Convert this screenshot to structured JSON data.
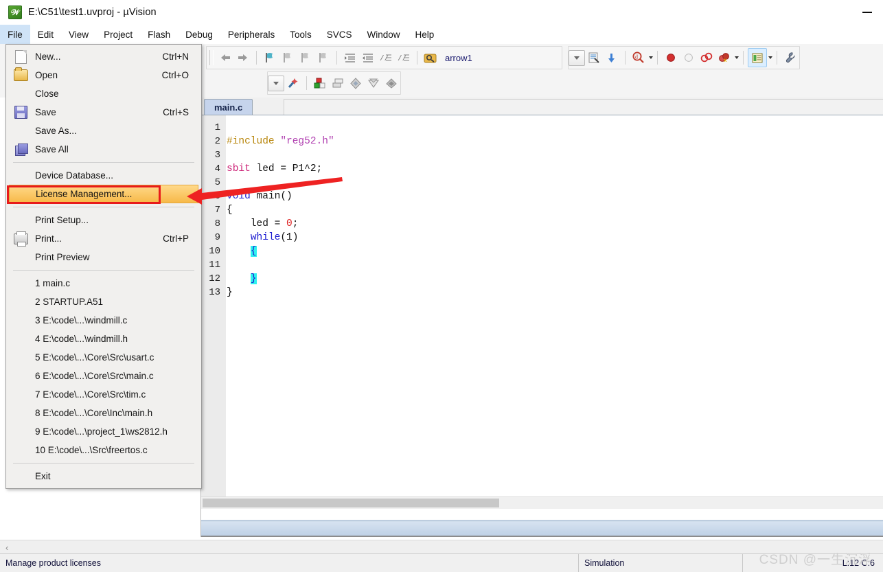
{
  "window": {
    "title": "E:\\C51\\test1.uvproj - µVision",
    "app_icon": "keil-uvision-icon",
    "minimize_label": "—"
  },
  "menubar": {
    "items": [
      {
        "label": "File",
        "open": true
      },
      {
        "label": "Edit",
        "open": false
      },
      {
        "label": "View",
        "open": false
      },
      {
        "label": "Project",
        "open": false
      },
      {
        "label": "Flash",
        "open": false
      },
      {
        "label": "Debug",
        "open": false
      },
      {
        "label": "Peripherals",
        "open": false
      },
      {
        "label": "Tools",
        "open": false
      },
      {
        "label": "SVCS",
        "open": false
      },
      {
        "label": "Window",
        "open": false
      },
      {
        "label": "Help",
        "open": false
      }
    ]
  },
  "file_menu": {
    "groups": [
      {
        "items": [
          {
            "label": "New...",
            "shortcut": "Ctrl+N",
            "icon": "new-file-icon",
            "highlighted": false
          },
          {
            "label": "Open",
            "shortcut": "Ctrl+O",
            "icon": "open-folder-icon",
            "highlighted": false
          },
          {
            "label": "Close",
            "shortcut": "",
            "icon": "",
            "highlighted": false
          },
          {
            "label": "Save",
            "shortcut": "Ctrl+S",
            "icon": "save-disk-icon",
            "highlighted": false
          },
          {
            "label": "Save As...",
            "shortcut": "",
            "icon": "",
            "highlighted": false
          },
          {
            "label": "Save All",
            "shortcut": "",
            "icon": "save-all-icon",
            "highlighted": false
          }
        ]
      },
      {
        "items": [
          {
            "label": "Device Database...",
            "shortcut": "",
            "icon": "",
            "highlighted": false
          },
          {
            "label": "License Management...",
            "shortcut": "",
            "icon": "",
            "highlighted": true
          }
        ]
      },
      {
        "items": [
          {
            "label": "Print Setup...",
            "shortcut": "",
            "icon": "",
            "highlighted": false
          },
          {
            "label": "Print...",
            "shortcut": "Ctrl+P",
            "icon": "printer-icon",
            "highlighted": false
          },
          {
            "label": "Print Preview",
            "shortcut": "",
            "icon": "",
            "highlighted": false
          }
        ]
      },
      {
        "items": [
          {
            "label": "1 main.c",
            "shortcut": "",
            "icon": "",
            "highlighted": false
          },
          {
            "label": "2 STARTUP.A51",
            "shortcut": "",
            "icon": "",
            "highlighted": false
          },
          {
            "label": "3 E:\\code\\...\\windmill.c",
            "shortcut": "",
            "icon": "",
            "highlighted": false
          },
          {
            "label": "4 E:\\code\\...\\windmill.h",
            "shortcut": "",
            "icon": "",
            "highlighted": false
          },
          {
            "label": "5 E:\\code\\...\\Core\\Src\\usart.c",
            "shortcut": "",
            "icon": "",
            "highlighted": false
          },
          {
            "label": "6 E:\\code\\...\\Core\\Src\\main.c",
            "shortcut": "",
            "icon": "",
            "highlighted": false
          },
          {
            "label": "7 E:\\code\\...\\Core\\Src\\tim.c",
            "shortcut": "",
            "icon": "",
            "highlighted": false
          },
          {
            "label": "8 E:\\code\\...\\Core\\Inc\\main.h",
            "shortcut": "",
            "icon": "",
            "highlighted": false
          },
          {
            "label": "9 E:\\code\\...\\project_1\\ws2812.h",
            "shortcut": "",
            "icon": "",
            "highlighted": false
          },
          {
            "label": "10 E:\\code\\...\\Src\\freertos.c",
            "shortcut": "",
            "icon": "",
            "highlighted": false
          }
        ]
      },
      {
        "items": [
          {
            "label": "Exit",
            "shortcut": "",
            "icon": "",
            "highlighted": false
          }
        ]
      }
    ]
  },
  "toolbar": {
    "target_label": "arrow1",
    "row1_icons": [
      "back-arrow-icon",
      "forward-arrow-icon",
      "bookmark-toggle-icon",
      "bookmark-prev-icon",
      "bookmark-next-icon",
      "bookmark-clear-icon",
      "indent-right-icon",
      "indent-left-icon",
      "comment-icon",
      "uncomment-icon",
      "target-options-icon"
    ],
    "row1_right_icons": [
      "target-dropdown-icon",
      "manage-project-items-icon",
      "configure-icon",
      "find-in-files-icon",
      "insert-breakpoint-icon",
      "disable-breakpoint-icon",
      "kill-all-breakpoints-icon",
      "disable-all-breakpoints-icon",
      "window-layout-icon",
      "utilities-icon"
    ],
    "row2_icons": [
      "dropdown-icon",
      "build-wizard-icon",
      "target-build-icon",
      "batch-build-icon",
      "translate-icon",
      "download-icon",
      "manage-components-icon"
    ]
  },
  "editor": {
    "tab_label": "main.c",
    "lines": [
      {
        "num": "1",
        "tokens": []
      },
      {
        "num": "2",
        "tokens": [
          {
            "t": "#include ",
            "c": "k-pre"
          },
          {
            "t": "\"reg52.h\"",
            "c": "k-str"
          }
        ]
      },
      {
        "num": "3",
        "tokens": []
      },
      {
        "num": "4",
        "tokens": [
          {
            "t": "sbit",
            "c": "k-type"
          },
          {
            "t": " led = P1^2;",
            "c": "k-plain"
          }
        ]
      },
      {
        "num": "5",
        "tokens": []
      },
      {
        "num": "6",
        "tokens": [
          {
            "t": "void",
            "c": "k-kw"
          },
          {
            "t": " main()",
            "c": "k-plain"
          }
        ]
      },
      {
        "num": "7",
        "tokens": [
          {
            "t": "{",
            "c": "k-plain"
          }
        ]
      },
      {
        "num": "8",
        "tokens": [
          {
            "t": "    led = ",
            "c": "k-plain"
          },
          {
            "t": "0",
            "c": "k-num"
          },
          {
            "t": ";",
            "c": "k-plain"
          }
        ]
      },
      {
        "num": "9",
        "tokens": [
          {
            "t": "    ",
            "c": "k-plain"
          },
          {
            "t": "while",
            "c": "k-kw"
          },
          {
            "t": "(1)",
            "c": "k-plain"
          }
        ]
      },
      {
        "num": "10",
        "tokens": [
          {
            "t": "    ",
            "c": "k-plain"
          },
          {
            "t": "{",
            "c": "brace-hl"
          }
        ]
      },
      {
        "num": "11",
        "tokens": []
      },
      {
        "num": "12",
        "tokens": [
          {
            "t": "    ",
            "c": "k-plain"
          },
          {
            "t": "}",
            "c": "brace-hl"
          }
        ]
      },
      {
        "num": "13",
        "tokens": [
          {
            "t": "}",
            "c": "k-plain"
          }
        ]
      }
    ]
  },
  "statusbar": {
    "message": "Manage product licenses",
    "simulation": "Simulation",
    "position": "L:12 C:6"
  },
  "annotations": {
    "highlight_target": "License Management...",
    "box_color": "#e81b1b",
    "arrow_color": "#ee2222"
  },
  "watermark": {
    "text": "CSDN @一生沉浮"
  },
  "colors": {
    "menu_open_highlight": "#cfe3f7",
    "menu_item_highlight_top": "#ffd98a",
    "menu_item_highlight_bottom": "#f7b948",
    "tab_active": "#c6d4ec",
    "brace_match": "#2ef1ef"
  }
}
